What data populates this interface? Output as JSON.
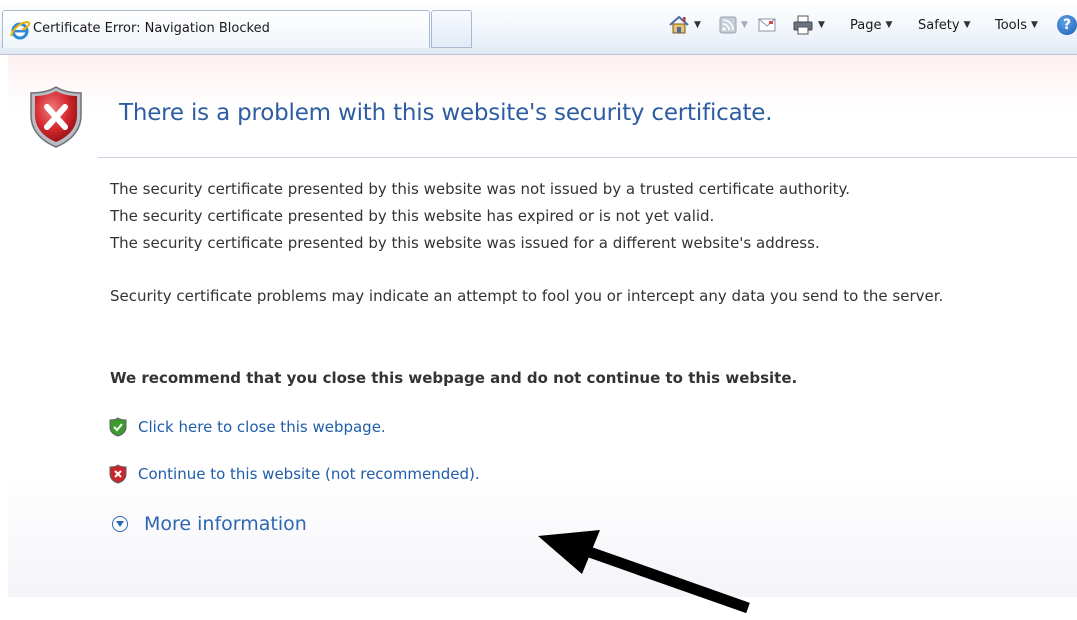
{
  "browser": {
    "tab_title": "Certificate Error: Navigation Blocked",
    "toolbar": {
      "home_icon": "home-icon",
      "feeds_icon": "feeds-icon",
      "mail_icon": "mail-icon",
      "print_icon": "print-icon",
      "page_label": "Page",
      "safety_label": "Safety",
      "tools_label": "Tools",
      "help_icon": "help-icon",
      "help_glyph": "?"
    }
  },
  "page": {
    "headline": "There is a problem with this website's security certificate.",
    "reasons": [
      "The security certificate presented by this website was not issued by a trusted certificate authority.",
      "The security certificate presented by this website has expired or is not yet valid.",
      "The security certificate presented by this website was issued for a different website's address."
    ],
    "warning": "Security certificate problems may indicate an attempt to fool you or intercept any data you send to the server.",
    "recommendation": "We recommend that you close this webpage and do not continue to this website.",
    "close_link": "Click here to close this webpage.",
    "continue_link": "Continue to this website (not recommended).",
    "more_info": "More information"
  },
  "colors": {
    "headline": "#2e5ca2",
    "link": "#1f5dab",
    "error_red": "#c8262b",
    "safe_green": "#3c9a2f"
  }
}
